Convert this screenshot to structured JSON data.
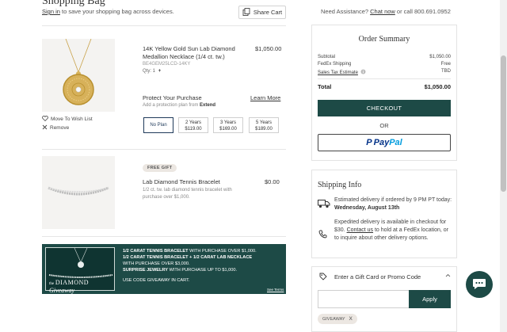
{
  "header": {
    "cut_title": "Shopping Bag",
    "signin_link": "Sign in",
    "signin_rest": "to save your shopping bag across devices.",
    "share_label": "Share Cart",
    "assist_prefix": "Need Assistance?",
    "assist_chat": "Chat now",
    "assist_suffix": "or call 800.691.0952"
  },
  "items": [
    {
      "title": "14K Yellow Gold Sun Lab Diamond Medallion Necklace (1/4 ct. tw.)",
      "sku": "BE4GEM25LCD-14KY",
      "qty_label": "Qty: 1",
      "price": "$1,050.00",
      "wishlist": "Move To Wish List",
      "remove": "Remove",
      "protect_title": "Protect Your Purchase",
      "protect_sub": "Add a protection plan from",
      "protect_brand": "Extend",
      "learn_more": "Learn More",
      "plans": [
        {
          "line1": "No Plan",
          "line2": ""
        },
        {
          "line1": "2 Years",
          "line2": "$119.00"
        },
        {
          "line1": "3 Years",
          "line2": "$169.00"
        },
        {
          "line1": "5 Years",
          "line2": "$189.00"
        }
      ]
    },
    {
      "badge": "FREE GIFT",
      "title": "Lab Diamond Tennis Bracelet",
      "desc": "1/2 ct. tw. lab diamond tennis bracelet with purchase over $1,000.",
      "price": "$0.00"
    }
  ],
  "banner": {
    "img_line1": "the",
    "img_line2": "DIAMOND",
    "img_line3": "Giveaway",
    "l1b": "1/2 CARAT TENNIS BRACELET",
    "l1": " WITH PURCHASE OVER $1,000.",
    "l2b": "1/2 CARAT TENNIS BRACELET + 1/2 CARAT LAB NECKLACE",
    "l3": "WITH PURCHASE OVER $3,000.",
    "l4b": "SURPRISE JEWELRY",
    "l4": " WITH PURCHASE UP TO $1,000.",
    "code": "USE CODE GIVEAWAY IN CART.",
    "terms": "See Terms"
  },
  "summary": {
    "title": "Order Summary",
    "rows": [
      {
        "label": "Subtotal",
        "value": "$1,050.00"
      },
      {
        "label": "FedEx Shipping",
        "value": "Free"
      },
      {
        "label": "Sales Tax Estimate",
        "value": "TBD"
      }
    ],
    "total_label": "Total",
    "total_value": "$1,050.00",
    "checkout": "CHECKOUT",
    "or": "OR",
    "paypal_pay": "Pay",
    "paypal_pal": "Pal"
  },
  "shipping": {
    "title": "Shipping Info",
    "est_prefix": "Estimated delivery if ordered by 9 PM PT today: ",
    "est_date": "Wednesday, August 13th",
    "exp_prefix": "Expedited delivery is available in checkout for $30. ",
    "exp_link": "Contact us",
    "exp_suffix": " to hold at a FedEx location, or to inquire about other delivery options."
  },
  "promo": {
    "label": "Enter a Gift Card or Promo Code",
    "input_value": "",
    "apply": "Apply",
    "applied_code": "GIVEAWAY",
    "remove_x": "X"
  },
  "colors": {
    "brand": "#1d4a46",
    "paypal_dark": "#003087",
    "paypal_light": "#009cde"
  }
}
